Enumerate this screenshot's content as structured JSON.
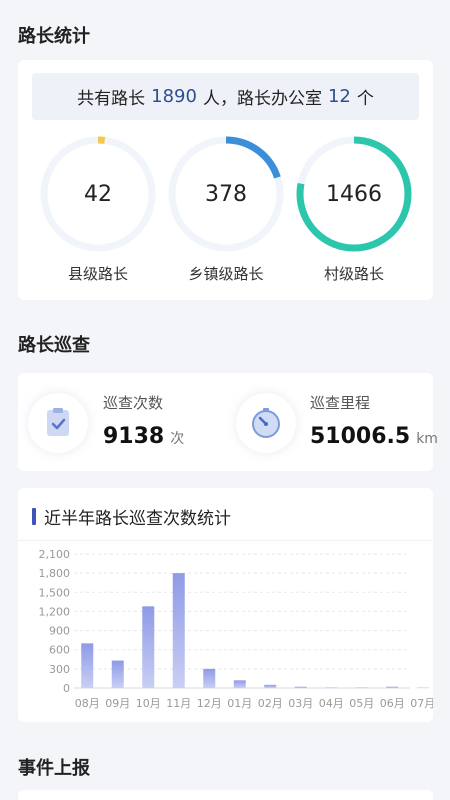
{
  "section_road_chief_stats": {
    "title": "路长统计"
  },
  "summary": {
    "prefix": "共有路长",
    "total_chiefs": "1890",
    "mid": "人，路长办公室",
    "offices": "12",
    "suffix": "个"
  },
  "rings": [
    {
      "value": "42",
      "label": "县级路长",
      "fraction": 0.02,
      "color": "#f2c94c"
    },
    {
      "value": "378",
      "label": "乡镇级路长",
      "fraction": 0.2,
      "color": "#3b8fd9"
    },
    {
      "value": "1466",
      "label": "村级路长",
      "fraction": 0.78,
      "color": "#2cc6ad"
    }
  ],
  "section_patrol": {
    "title": "路长巡查"
  },
  "patrol": {
    "count_label": "巡查次数",
    "count_value": "9138",
    "count_unit": "次",
    "mileage_label": "巡查里程",
    "mileage_value": "51006.5",
    "mileage_unit": "km",
    "count_icon": "clipboard-check-icon",
    "mileage_icon": "stopwatch-icon"
  },
  "chart_title": "近半年路长巡查次数统计",
  "chart_data": {
    "type": "bar",
    "categories": [
      "08月",
      "09月",
      "10月",
      "11月",
      "12月",
      "01月",
      "02月",
      "03月",
      "04月",
      "05月",
      "06月",
      "07月"
    ],
    "values": [
      700,
      430,
      1280,
      1800,
      300,
      120,
      50,
      20,
      5,
      8,
      20,
      5
    ],
    "ylim": [
      0,
      2100
    ],
    "yticks": [
      "0",
      "300",
      "600",
      "900",
      "1,200",
      "1,500",
      "1,800",
      "2,100"
    ],
    "grid": true,
    "bar_color_top": "#8e9ae6",
    "bar_color_bottom": "#c9cff4"
  },
  "section_event_report": {
    "title": "事件上报"
  }
}
